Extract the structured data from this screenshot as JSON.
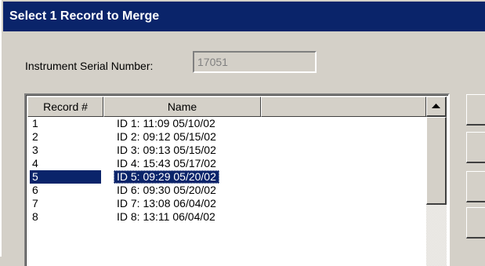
{
  "window": {
    "title": "Select 1 Record to Merge"
  },
  "serial": {
    "label": "Instrument Serial Number:",
    "value": "17051"
  },
  "list": {
    "columns": [
      "Record #",
      "Name",
      ""
    ],
    "rows": [
      {
        "record": "1",
        "name": "ID 1: 11:09 05/10/02",
        "selected": false
      },
      {
        "record": "2",
        "name": "ID 2: 09:12 05/15/02",
        "selected": false
      },
      {
        "record": "3",
        "name": "ID 3: 09:13 05/15/02",
        "selected": false
      },
      {
        "record": "4",
        "name": "ID 4: 15:43 05/17/02",
        "selected": false
      },
      {
        "record": "5",
        "name": "ID 5: 09:29 05/20/02",
        "selected": true
      },
      {
        "record": "6",
        "name": "ID 6: 09:30 05/20/02",
        "selected": false
      },
      {
        "record": "7",
        "name": "ID 7: 13:08 06/04/02",
        "selected": false
      },
      {
        "record": "8",
        "name": "ID 8: 13:11 06/04/02",
        "selected": false
      }
    ]
  },
  "colors": {
    "title_bg": "#0a246a",
    "face": "#d4d0c8",
    "selection": "#0a246a"
  },
  "icons": {
    "scroll_up": "triangle-up-icon"
  }
}
